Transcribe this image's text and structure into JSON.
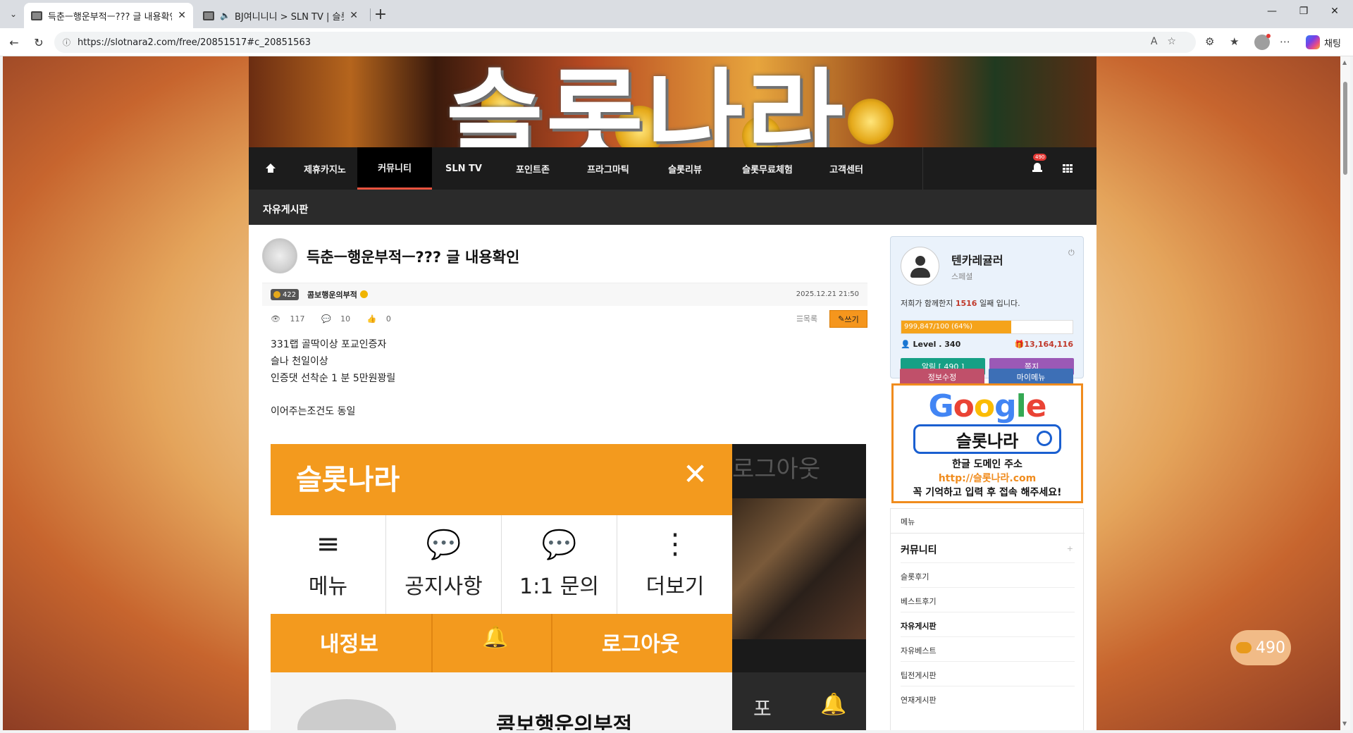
{
  "browser": {
    "tabs": [
      {
        "title": "득춘ㅡ행운부적ㅡ??? 글 내용확인",
        "active": true
      },
      {
        "title": "BJ여니니니 > SLN TV | 슬롯나",
        "active": false
      }
    ],
    "url": "https://slotnara2.com/free/20851517#c_20851563",
    "copilot_label": "채팅"
  },
  "site": {
    "banner_title": "슬롯나라",
    "nav": {
      "items": [
        "제휴카지노",
        "커뮤니티",
        "SLN TV",
        "포인트존",
        "프라그마틱",
        "슬롯리뷰",
        "슬롯무료체험",
        "고객센터"
      ],
      "active": "커뮤니티",
      "notification_count": "490"
    },
    "section_title": "자유게시판"
  },
  "post": {
    "title": "득춘ㅡ행운부적ㅡ??? 글 내용확인",
    "author_level": "422",
    "author": "콤보행운의부적",
    "date": "2025.12.21 21:50",
    "views": "117",
    "comments": "10",
    "likes": "0",
    "list_label": "목록",
    "write_label": "쓰기",
    "lines": [
      "331랩 골딱이상 포교인증자",
      "슬나 천일이상",
      "인증댓 선착순 1 분 5만원꽝릴",
      "이어주는조건도 동일"
    ]
  },
  "embedded_screenshot": {
    "app_title": "슬롯나라",
    "close_glyph": "✕",
    "menu": [
      {
        "icon": "≡",
        "label": "메뉴"
      },
      {
        "icon": "💬",
        "label": "공지사항"
      },
      {
        "icon": "💬",
        "label": "1:1 문의"
      },
      {
        "icon": "⋮",
        "label": "더보기"
      }
    ],
    "bar": {
      "left": "내정보",
      "right": "로그아웃"
    },
    "bottom_name": "콤보행운의부적",
    "side_ghost": "로그아웃",
    "side_bottom_left": "포"
  },
  "sidebar": {
    "profile": {
      "name": "텐카레귤러",
      "grade": "스페셜",
      "days_prefix": "저희가 함께한지 ",
      "days": "1516",
      "days_suffix": "일째 입니다.",
      "xp_text": "999,847/100 (64%)",
      "xp_percent": 64,
      "level": "Level . 340",
      "points": "13,164,116",
      "buttons": {
        "alarm": "알림 [ 490 ]",
        "memo": "쪽지",
        "edit": "정보수정",
        "mymenu": "마이메뉴"
      }
    },
    "ad": {
      "google": "Google",
      "search_text": "슬롯나라",
      "line1": "한글 도메인 주소",
      "line2": "http://슬롯나라.com",
      "line3": "꼭 기억하고 입력 후 접속 해주세요!"
    },
    "menu": {
      "header": "메뉴",
      "category": "커뮤니티",
      "items": [
        "슬롯후기",
        "베스트후기",
        "자유게시판",
        "자유베스트",
        "팁전게시판",
        "연재게시판"
      ],
      "active": "자유게시판"
    }
  },
  "chat_float": {
    "count": "490"
  },
  "colors": {
    "accent": "#f39a1e",
    "nav_bg": "#1c1c1c",
    "alarm_btn": "#16a085",
    "memo_btn": "#9b59b6",
    "edit_btn": "#c0506a",
    "mymenu_btn": "#3d6fb6"
  }
}
